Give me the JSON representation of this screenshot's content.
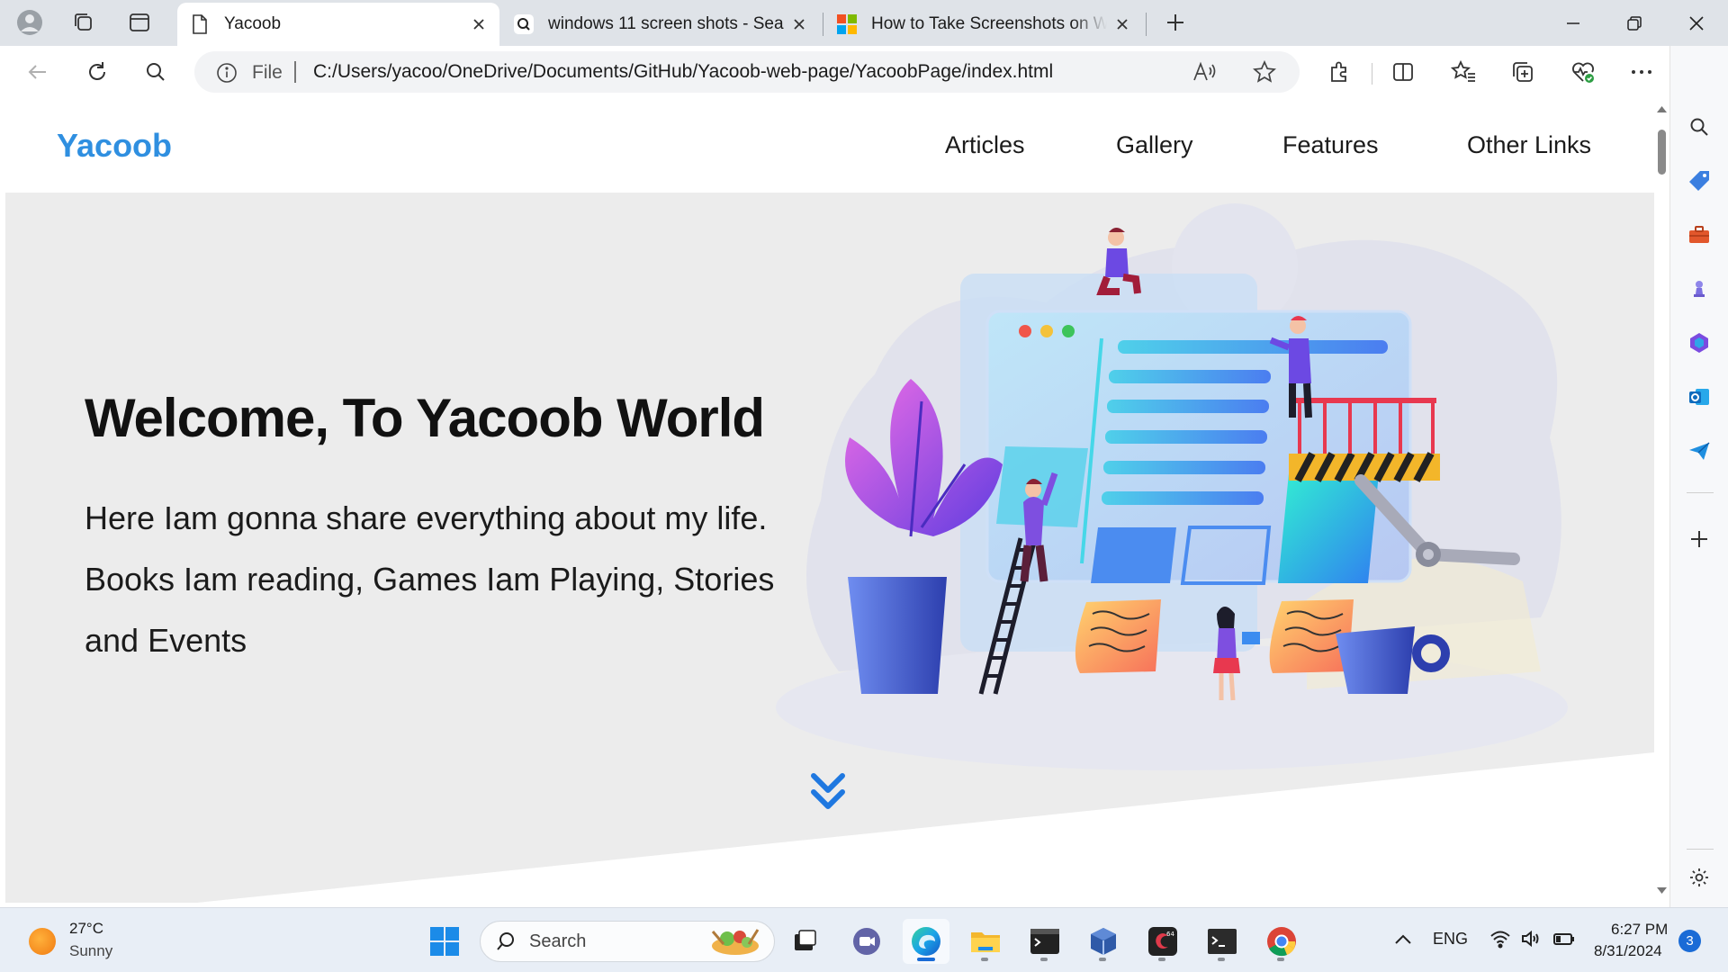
{
  "browser": {
    "tabs": [
      {
        "title": "Yacoob",
        "icon": "page-icon",
        "active": true
      },
      {
        "title": "windows 11 screen shots - Search",
        "icon": "search-icon",
        "active": false
      },
      {
        "title": "How to Take Screenshots on Windows",
        "icon": "microsoft-logo-icon",
        "active": false
      }
    ],
    "address": {
      "scheme_label": "File",
      "url": "C:/Users/yacoo/OneDrive/Documents/GitHub/Yacoob-web-page/YacoobPage/index.html"
    }
  },
  "site": {
    "brand": "Yacoob",
    "brand_color": "#2f8fe0",
    "nav": [
      "Articles",
      "Gallery",
      "Features",
      "Other Links"
    ],
    "hero": {
      "title": "Welcome, To Yacoob World",
      "text": "Here Iam gonna share everything about my life. Books Iam reading, Games Iam Playing, Stories and Events"
    }
  },
  "taskbar": {
    "weather": {
      "temp": "27°C",
      "condition": "Sunny"
    },
    "search_placeholder": "Search",
    "language": "ENG",
    "time": "6:27 PM",
    "date": "8/31/2024",
    "notifications": "3"
  }
}
